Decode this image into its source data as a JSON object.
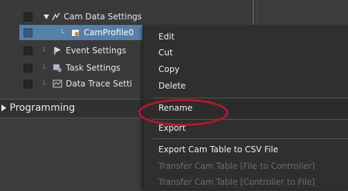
{
  "tree": {
    "cam_data_settings": "Cam Data Settings",
    "cam_profile": "CamProfile0",
    "event_settings": "Event Settings",
    "task_settings": "Task Settings",
    "data_trace_settings": "Data Trace Setti"
  },
  "programming": {
    "label": "Programming"
  },
  "context_menu": {
    "edit": "Edit",
    "cut": "Cut",
    "copy": "Copy",
    "delete": "Delete",
    "rename": "Rename",
    "export": "Export",
    "export_cam_table": "Export Cam Table to CSV File",
    "transfer_file_to_controller": "Transfer Cam Table [File to Controller]",
    "transfer_controller_to_file": "Transfer Cam Table [Controller to File]"
  },
  "colors": {
    "selection": "#5580a8",
    "highlight_ring": "#c8102e",
    "menu_bg": "#2f2f2f"
  },
  "icons": {
    "expand": "triangle-down-icon",
    "cam": "cam-icon",
    "cam_profile": "cam-profile-icon",
    "event": "flag-icon",
    "task": "task-icon",
    "trace": "chart-icon",
    "collapsed": "triangle-right-icon"
  }
}
